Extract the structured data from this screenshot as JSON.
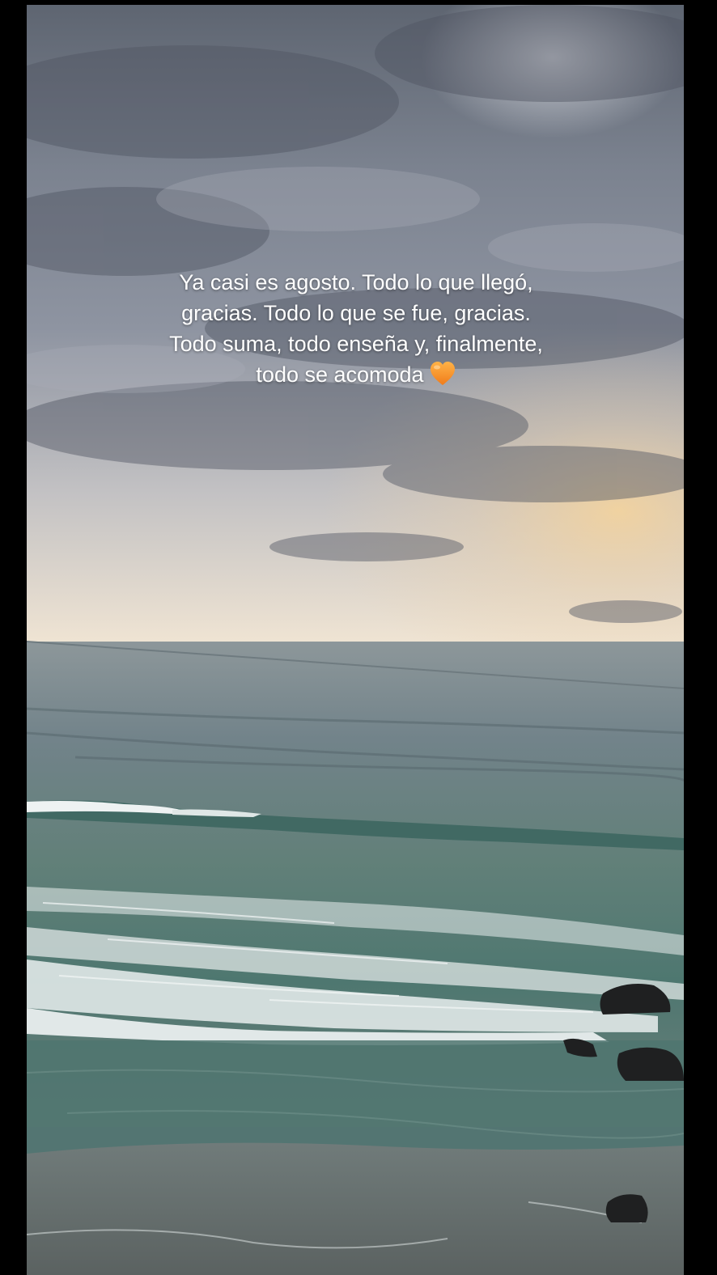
{
  "story": {
    "caption_lines": [
      "Ya casi es agosto. Todo lo que llegó,",
      "gracias. Todo lo que se fue, gracias.",
      "Todo suma, todo enseña y, finalmente,",
      "todo se acomoda"
    ],
    "caption_emoji": "orange-heart-icon"
  },
  "photo": {
    "scene": "cloudy-sunset-ocean-beach",
    "colors": {
      "sky_top": "#5d6470",
      "sky_mid": "#8f95a2",
      "sky_glow": "#f1d7aa",
      "horizon": "#f3e5cf",
      "sea_far": "#7d8a8e",
      "sea_near": "#4f7a73",
      "foam": "#e8eeee",
      "rocks": "#1f1f20"
    }
  }
}
